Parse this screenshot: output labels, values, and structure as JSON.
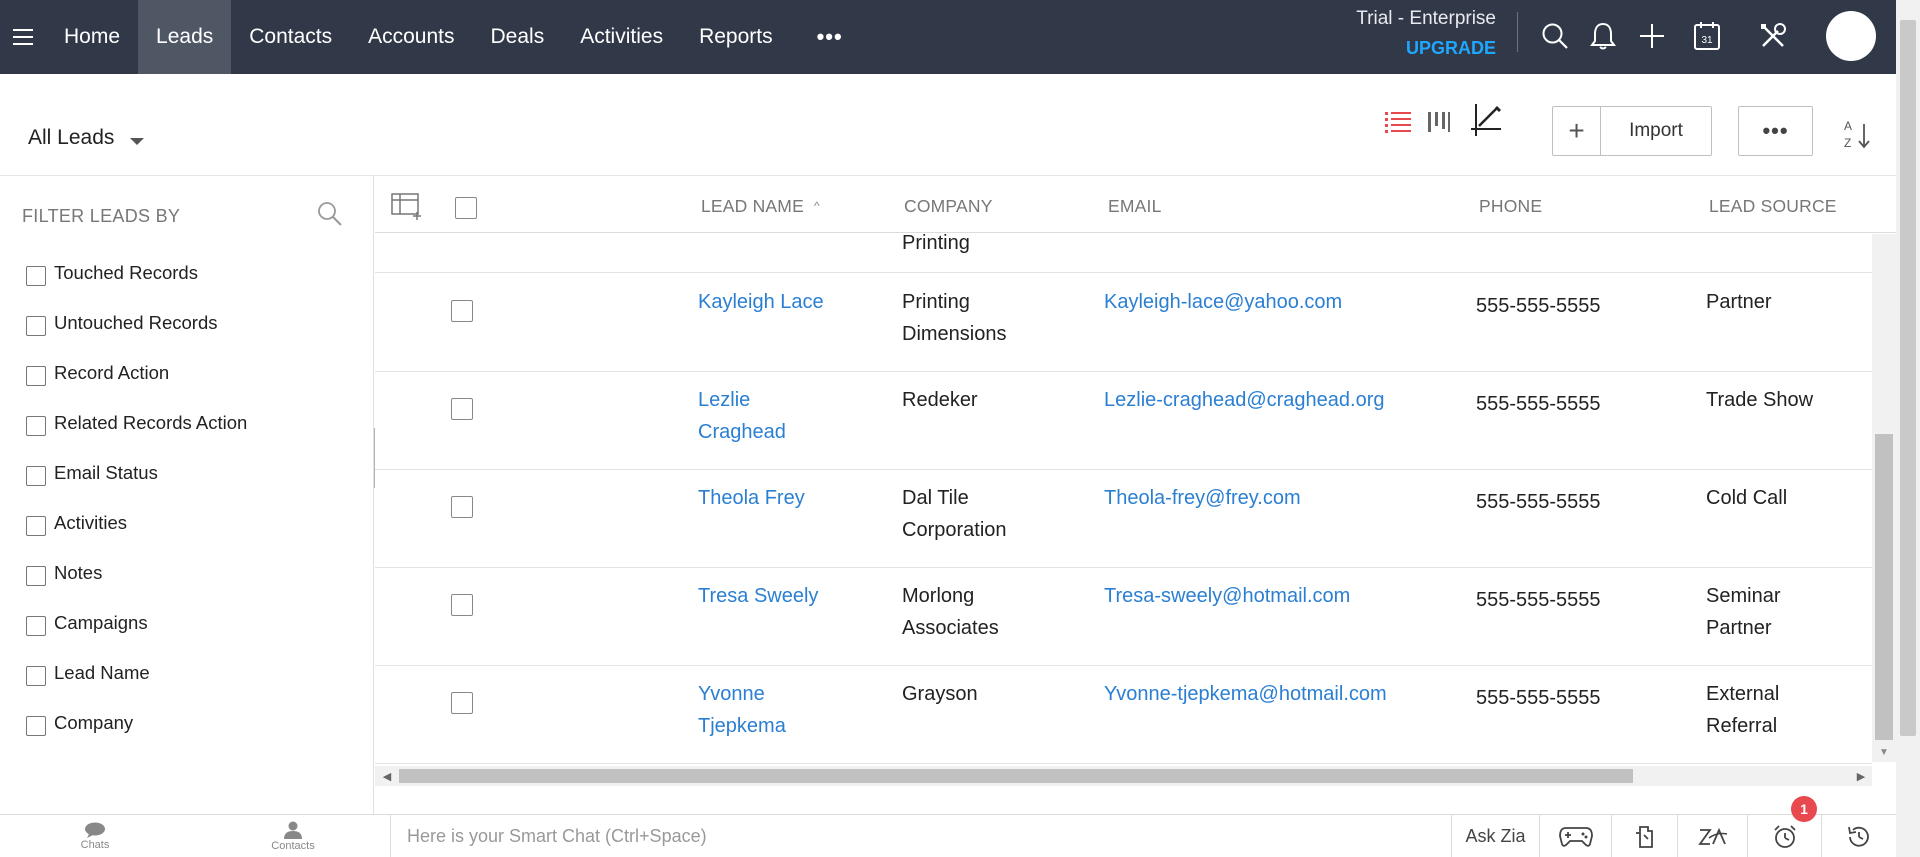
{
  "nav": {
    "items": [
      {
        "label": "Home",
        "active": false
      },
      {
        "label": "Leads",
        "active": true
      },
      {
        "label": "Contacts",
        "active": false
      },
      {
        "label": "Accounts",
        "active": false
      },
      {
        "label": "Deals",
        "active": false
      },
      {
        "label": "Activities",
        "active": false
      },
      {
        "label": "Reports",
        "active": false
      }
    ],
    "more_label": "•••",
    "trial_label": "Trial - Enterprise",
    "upgrade_label": "UPGRADE",
    "icons": [
      "search-icon",
      "bell-icon",
      "plus-icon",
      "calendar-icon",
      "tools-icon",
      "avatar"
    ],
    "calendar_day": "31"
  },
  "toolbar": {
    "view_label": "All Leads",
    "view_icons": [
      "list-view-icon",
      "kanban-view-icon",
      "canvas-view-icon"
    ],
    "plus_label": "+",
    "import_label": "Import",
    "more_label": "•••",
    "sort_icon": "sort-az-icon"
  },
  "sidebar": {
    "heading": "FILTER LEADS BY",
    "filters": [
      "Touched Records",
      "Untouched Records",
      "Record Action",
      "Related Records Action",
      "Email Status",
      "Activities",
      "Notes",
      "Campaigns",
      "Lead Name",
      "Company"
    ]
  },
  "table": {
    "columns": [
      "LEAD NAME",
      "COMPANY",
      "EMAIL",
      "PHONE",
      "LEAD SOURCE"
    ],
    "sort_column": "LEAD NAME",
    "sort_indicator": "^",
    "partial_row": {
      "company": "Printing"
    },
    "rows": [
      {
        "name": "Kayleigh Lace",
        "company": "Printing Dimensions",
        "email": "Kayleigh-lace@yahoo.com",
        "phone": "555-555-5555",
        "source": "Partner"
      },
      {
        "name": "Lezlie Craghead",
        "company": "Redeker",
        "email": "Lezlie-craghead@craghead.org",
        "phone": "555-555-5555",
        "source": "Trade Show"
      },
      {
        "name": "Theola Frey",
        "company": "Dal Tile Corporation",
        "email": "Theola-frey@frey.com",
        "phone": "555-555-5555",
        "source": "Cold Call"
      },
      {
        "name": "Tresa Sweely",
        "company": "Morlong Associates",
        "email": "Tresa-sweely@hotmail.com",
        "phone": "555-555-5555",
        "source": "Seminar Partner"
      },
      {
        "name": "Yvonne Tjepkema",
        "company": "Grayson",
        "email": "Yvonne-tjepkema@hotmail.com",
        "phone": "555-555-5555",
        "source": "External Referral"
      }
    ]
  },
  "bottom": {
    "chats_label": "Chats",
    "contacts_label": "Contacts",
    "smartchat_placeholder": "Here is your Smart Chat (Ctrl+Space)",
    "askzia_label": "Ask Zia",
    "notification_count": "1"
  },
  "colors": {
    "nav_bg": "#313949",
    "nav_active": "#4f5765",
    "link": "#2a7fd2",
    "upgrade": "#1ea7ff",
    "list_view_active": "#e8494f",
    "badge": "#e8494f"
  }
}
